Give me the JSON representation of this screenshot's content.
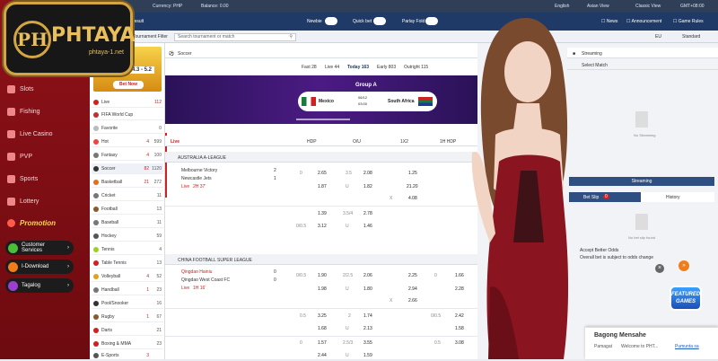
{
  "logo": {
    "mark": "PH",
    "name": "PHTAYA",
    "domain": "phtaya-1.net"
  },
  "topbar": {
    "currency": "Currency: PHP",
    "balance": "Balance: 0.00",
    "language": "English",
    "odds_view": "Asian View",
    "layout_view": "Classic View",
    "timezone": "GMT+08:00"
  },
  "toolbar": {
    "result": "Result",
    "newbie": "Newbie",
    "quick_bet": "Quick bet",
    "parlay_fold": "Parlay Fold",
    "news": "News",
    "announcement": "Announcement",
    "game_rules": "Game Rules"
  },
  "filter": {
    "tournament_filter": "Tournament Filter",
    "search_placeholder": "Search tournament or match",
    "region": "EU",
    "standard": "Standard"
  },
  "nav": {
    "items": [
      {
        "label": "Slots",
        "color": "#f3a2a2"
      },
      {
        "label": "Fishing",
        "color": "#f3a2a2"
      },
      {
        "label": "Live Casino",
        "color": "#f3a2a2"
      },
      {
        "label": "PVP",
        "color": "#f3a2a2"
      },
      {
        "label": "Sports",
        "color": "#f3a2a2"
      },
      {
        "label": "Lottery",
        "color": "#f3a2a2"
      }
    ],
    "promotion": "Promotion",
    "pills": [
      {
        "label": "Customer Services",
        "color": "#4bbf3a"
      },
      {
        "label": "I-Download",
        "color": "#f07d1b"
      },
      {
        "label": "Tagalog",
        "color": "#9b3fd0"
      }
    ]
  },
  "banner": {
    "score": "4.3 - 5.2",
    "cta": "Bet Now"
  },
  "sports": [
    {
      "name": "Live",
      "n1": "",
      "n2": "112",
      "color": "#c22"
    },
    {
      "name": "FIFA World Cup",
      "n1": "",
      "n2": "",
      "color": "#333"
    },
    {
      "name": "Favorite",
      "n1": "",
      "n2": "0",
      "color": "#999"
    },
    {
      "name": "Hot",
      "n1": "4",
      "n2": "599",
      "color": "#e44"
    },
    {
      "name": "Fantasy",
      "n1": "4",
      "n2": "100",
      "color": "#777"
    },
    {
      "name": "Soccer",
      "n1": "82",
      "n2": "1120",
      "color": "#333"
    },
    {
      "name": "Basketball",
      "n1": "21",
      "n2": "272",
      "color": "#e07020"
    },
    {
      "name": "Cricket",
      "n1": "",
      "n2": "11",
      "color": "#777"
    },
    {
      "name": "Football",
      "n1": "",
      "n2": "13",
      "color": "#8a5a2a"
    },
    {
      "name": "Baseball",
      "n1": "",
      "n2": "11",
      "color": "#777"
    },
    {
      "name": "Hockey",
      "n1": "",
      "n2": "59",
      "color": "#555"
    },
    {
      "name": "Tennis",
      "n1": "",
      "n2": "4",
      "color": "#9bcf2a"
    },
    {
      "name": "Table Tennis",
      "n1": "",
      "n2": "13",
      "color": "#c22"
    },
    {
      "name": "Volleyball",
      "n1": "4",
      "n2": "52",
      "color": "#e0a020"
    },
    {
      "name": "Handball",
      "n1": "1",
      "n2": "23",
      "color": "#777"
    },
    {
      "name": "Pool/Snooker",
      "n1": "",
      "n2": "16",
      "color": "#333"
    },
    {
      "name": "Rugby",
      "n1": "1",
      "n2": "67",
      "color": "#8a5a2a"
    },
    {
      "name": "Darts",
      "n1": "",
      "n2": "21",
      "color": "#c22"
    },
    {
      "name": "Boxing & MMA",
      "n1": "",
      "n2": "23",
      "color": "#c22"
    },
    {
      "name": "E-Sports",
      "n1": "3",
      "n2": "",
      "color": "#555"
    }
  ],
  "main": {
    "section": "Soccer",
    "tabs": [
      "Fast 28",
      "Live 44",
      "Today 163",
      "Early 803",
      "Outright 115"
    ],
    "feature": {
      "group": "Group A",
      "home": "Mexico",
      "away": "South Africa",
      "date": "06/12",
      "time": "03:00"
    },
    "columns": {
      "live": "Live",
      "hdp": "HDP",
      "ou": "O/U",
      "x12": "1X2",
      "h1hdp": "1H HDP"
    },
    "league1": "AUSTRALIA A-LEAGUE",
    "match1": {
      "home": "Melbourne Victory",
      "away": "Newcastle Jets",
      "score_home": "2",
      "score_away": "1",
      "live": "Live",
      "time": "2H 37'"
    },
    "m1r1": {
      "h": "0",
      "hv": "2.65",
      "ou": "3.5",
      "ouv": "2.08",
      "x": "1.25"
    },
    "m1r2": {
      "hv": "1.87",
      "u": "U",
      "uv": "1.82",
      "x": "21.20"
    },
    "m1r3": {
      "x": "X",
      "xv": "4.08"
    },
    "m1r4": {
      "hv": "1.39",
      "ou": "3.5/4",
      "ouv": "2.78"
    },
    "m1r5": {
      "h": "0/0.5",
      "hv": "3.12",
      "u": "U",
      "uv": "1.46"
    },
    "league2": "CHINA FOOTBALL SUPER LEAGUE",
    "match2": {
      "home": "Qingdao Hainiu",
      "away": "Qingdao West Coast FC",
      "score_home": "0",
      "score_away": "0",
      "live": "Live",
      "time": "1H 16'"
    },
    "m2r1": {
      "h": "0/0.5",
      "hv": "1.90",
      "ou": "2/2.5",
      "ouv": "2.06",
      "x": "2.25",
      "h1": "0",
      "h1v": "1.66"
    },
    "m2r2": {
      "hv": "1.98",
      "u": "U",
      "uv": "1.80",
      "x": "2.94",
      "h1v": "2.28"
    },
    "m2r3": {
      "x": "X",
      "xv": "2.66"
    },
    "m2r4": {
      "h": "0.5",
      "hv": "3.25",
      "ou": "2",
      "ouv": "1.74",
      "h1": "0/0.5",
      "h1v": "2.42"
    },
    "m2r5": {
      "hv": "1.68",
      "u": "U",
      "uv": "2.13",
      "h1v": "1.58"
    },
    "m2r6": {
      "h": "0",
      "hv": "1.57",
      "ou": "2.5/3",
      "ouv": "3.55",
      "h1": "0.5",
      "h1v": "3.08"
    },
    "m2r7": {
      "hv": "2.44",
      "u": "U",
      "uv": "1.59"
    }
  },
  "right": {
    "streaming": "Streaming",
    "select_match": "Select Match",
    "no_streaming": "No Streaming",
    "streaming_btn": "Streaming",
    "bet_slip": "Bet Slip",
    "bet_slip_count": "0",
    "history": "History",
    "no_bet_slip": "No bet slip found",
    "accept": "Accept Better Odds",
    "note": "Overall bet is subject to odds change"
  },
  "featured": "FEATURED GAMES",
  "chat": {
    "title": "Bagong Mensahe",
    "from": "Pamagat",
    "preview": "Welcome to PHT...",
    "link": "Pumunta sa"
  }
}
